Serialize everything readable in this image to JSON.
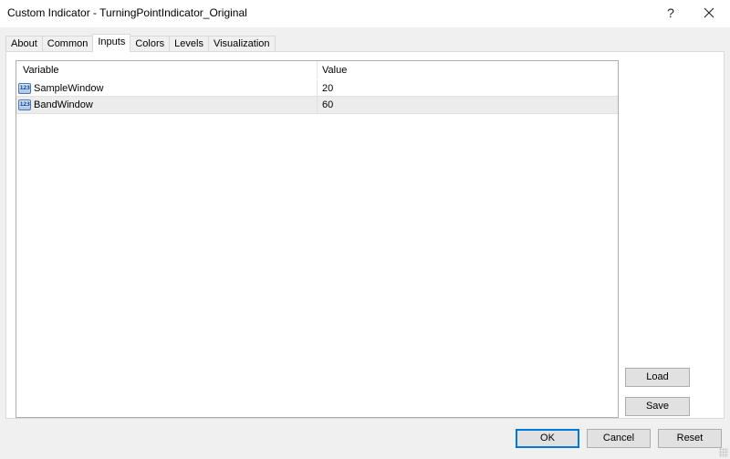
{
  "window": {
    "title": "Custom Indicator - TurningPointIndicator_Original",
    "help_label": "?",
    "close_icon": "close-icon"
  },
  "tabs": [
    {
      "label": "About",
      "active": false
    },
    {
      "label": "Common",
      "active": false
    },
    {
      "label": "Inputs",
      "active": true
    },
    {
      "label": "Colors",
      "active": false
    },
    {
      "label": "Levels",
      "active": false
    },
    {
      "label": "Visualization",
      "active": false
    }
  ],
  "inputs_grid": {
    "columns": [
      "Variable",
      "Value"
    ],
    "rows": [
      {
        "icon": "integer-123-icon",
        "variable": "SampleWindow",
        "value": "20"
      },
      {
        "icon": "integer-123-icon",
        "variable": "BandWindow",
        "value": "60"
      }
    ]
  },
  "side_buttons": {
    "load": "Load",
    "save": "Save"
  },
  "footer_buttons": {
    "ok": "OK",
    "cancel": "Cancel",
    "reset": "Reset"
  },
  "icon_glyph": "123"
}
